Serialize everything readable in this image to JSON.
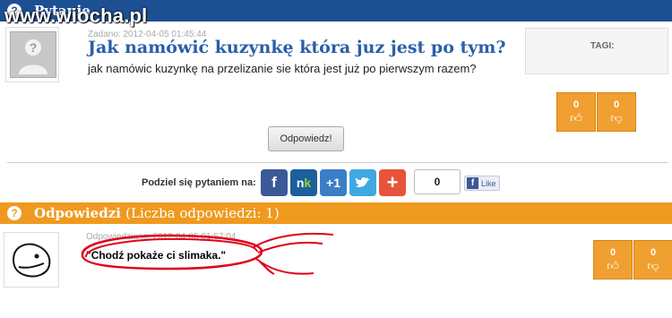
{
  "watermark": "www.wiocha.pl",
  "question_header": {
    "title": "Pytanie"
  },
  "question": {
    "meta": "Zadano: 2012-04-05 01:45:44",
    "title": "Jak namówić kuzynkę która juz jest po tym?",
    "body": "jak namówic kuzynkę na przelizanie sie która jest już po pierwszym razem?",
    "tags_label": "TAGI:",
    "votes": {
      "up": "0",
      "down": "0"
    },
    "answer_button": "Odpowiedz!"
  },
  "share": {
    "label": "Podziel się pytaniem na:",
    "icons": [
      "facebook-icon",
      "nk-icon",
      "google-plus-icon",
      "twitter-icon",
      "add-icon"
    ],
    "count": "0",
    "like_label": "Like"
  },
  "answers_header": {
    "title": "Odpowiedzi",
    "subtitle": "(Liczba odpowiedzi: 1)"
  },
  "answer": {
    "meta": "Odpowiedziano: 2012-04-05 01:57:04",
    "text": "\"Chodź pokaże ci slimaka.\"",
    "votes": {
      "up": "0",
      "down": "0"
    }
  },
  "colors": {
    "header_blue": "#1d4f93",
    "header_orange": "#ef9a1f",
    "vote_orange": "#f0a030",
    "annotation_red": "#e0001a"
  }
}
